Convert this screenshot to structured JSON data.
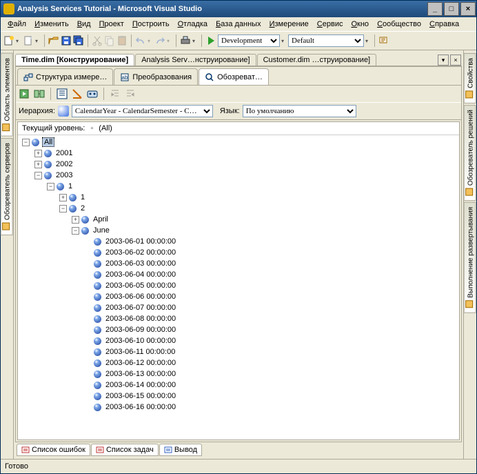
{
  "title": "Analysis Services Tutorial - Microsoft Visual Studio",
  "menu": [
    "Файл",
    "Изменить",
    "Вид",
    "Проект",
    "Построить",
    "Отладка",
    "База данных",
    "Измерение",
    "Сервис",
    "Окно",
    "Сообщество",
    "Справка"
  ],
  "config": {
    "sel": "Development",
    "plat": "Default"
  },
  "doctabs": [
    {
      "label": "Time.dim [Конструирование]",
      "active": true
    },
    {
      "label": "Analysis Serv…нструирование]",
      "active": false
    },
    {
      "label": "Customer.dim …струирование]",
      "active": false
    }
  ],
  "subtabs": [
    {
      "label": "Структура измере…",
      "active": false
    },
    {
      "label": "Преобразования",
      "active": false
    },
    {
      "label": "Обозреват…",
      "active": true
    }
  ],
  "hierLabel": "Иерархия:",
  "hierValue": "CalendarYear - CalendarSemester - C…",
  "langLabel": "Язык:",
  "langValue": "По умолчанию",
  "levelLabel": "Текущий уровень:",
  "levelValue": "(All)",
  "leftTabs": [
    "Область элементов",
    "Обозреватель серверов"
  ],
  "rightTabs": [
    "Свойства",
    "Обозреватель решений",
    "Выполнение развертывания"
  ],
  "tree": [
    {
      "d": 0,
      "t": "-",
      "l": "All",
      "sel": true
    },
    {
      "d": 1,
      "t": "+",
      "l": "2001"
    },
    {
      "d": 1,
      "t": "+",
      "l": "2002"
    },
    {
      "d": 1,
      "t": "-",
      "l": "2003"
    },
    {
      "d": 2,
      "t": "-",
      "l": "1"
    },
    {
      "d": 3,
      "t": "+",
      "l": "1"
    },
    {
      "d": 3,
      "t": "-",
      "l": "2"
    },
    {
      "d": 4,
      "t": "+",
      "l": "April"
    },
    {
      "d": 4,
      "t": "-",
      "l": "June"
    },
    {
      "d": 5,
      "t": "",
      "l": "2003-06-01 00:00:00"
    },
    {
      "d": 5,
      "t": "",
      "l": "2003-06-02 00:00:00"
    },
    {
      "d": 5,
      "t": "",
      "l": "2003-06-03 00:00:00"
    },
    {
      "d": 5,
      "t": "",
      "l": "2003-06-04 00:00:00"
    },
    {
      "d": 5,
      "t": "",
      "l": "2003-06-05 00:00:00"
    },
    {
      "d": 5,
      "t": "",
      "l": "2003-06-06 00:00:00"
    },
    {
      "d": 5,
      "t": "",
      "l": "2003-06-07 00:00:00"
    },
    {
      "d": 5,
      "t": "",
      "l": "2003-06-08 00:00:00"
    },
    {
      "d": 5,
      "t": "",
      "l": "2003-06-09 00:00:00"
    },
    {
      "d": 5,
      "t": "",
      "l": "2003-06-10 00:00:00"
    },
    {
      "d": 5,
      "t": "",
      "l": "2003-06-11 00:00:00"
    },
    {
      "d": 5,
      "t": "",
      "l": "2003-06-12 00:00:00"
    },
    {
      "d": 5,
      "t": "",
      "l": "2003-06-13 00:00:00"
    },
    {
      "d": 5,
      "t": "",
      "l": "2003-06-14 00:00:00"
    },
    {
      "d": 5,
      "t": "",
      "l": "2003-06-15 00:00:00"
    },
    {
      "d": 5,
      "t": "",
      "l": "2003-06-16 00:00:00"
    }
  ],
  "bottom": [
    {
      "label": "Список ошибок",
      "color": "#c03030"
    },
    {
      "label": "Список задач",
      "color": "#c03030"
    },
    {
      "label": "Вывод",
      "color": "#3060c0"
    }
  ],
  "status": "Готово"
}
